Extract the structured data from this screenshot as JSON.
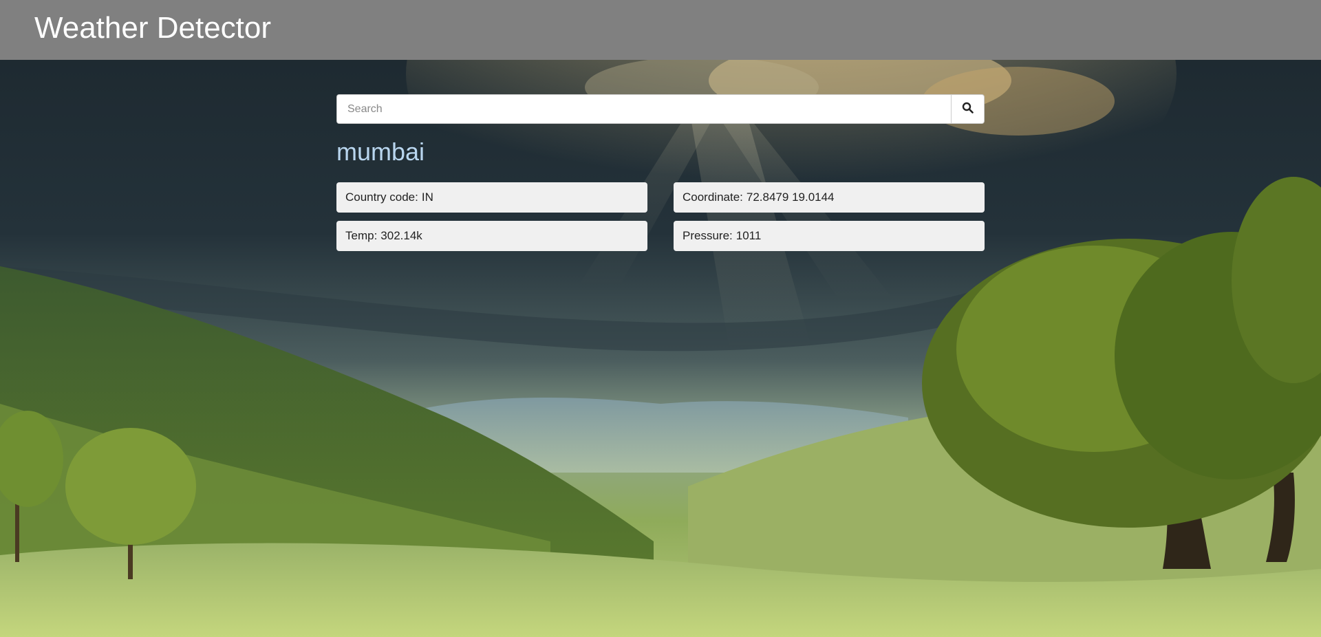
{
  "header": {
    "title": "Weather Detector"
  },
  "search": {
    "placeholder": "Search",
    "value": "",
    "button_icon": "search-icon"
  },
  "result": {
    "city": "mumbai",
    "country_label": "Country code:",
    "country_value": "IN",
    "coordinate_label": "Coordinate:",
    "coordinate_value": "72.8479 19.0144",
    "temp_label": "Temp:",
    "temp_value": "302.14k",
    "pressure_label": "Pressure:",
    "pressure_value": "1011"
  },
  "colors": {
    "header_bg": "#808080",
    "city_text": "#b9d6ef",
    "card_bg": "#f0f0f0"
  }
}
